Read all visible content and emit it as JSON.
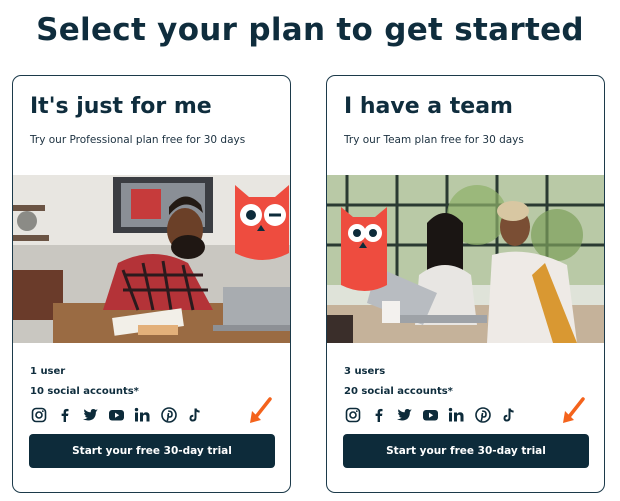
{
  "headline": "Select your plan to get started",
  "plans": [
    {
      "title": "It's just for me",
      "subtitle": "Try our Professional plan free for 30 days",
      "users": "1 user",
      "accounts": "10 social accounts*",
      "cta": "Start your free 30-day trial",
      "image": "man-working-at-desk-photo"
    },
    {
      "title": "I have a team",
      "subtitle": "Try our Team plan free for 30 days",
      "users": "3 users",
      "accounts": "20 social accounts*",
      "cta": "Start your free 30-day trial",
      "image": "two-women-at-laptop-photo"
    }
  ],
  "socials": [
    "instagram-icon",
    "facebook-icon",
    "twitter-icon",
    "youtube-icon",
    "linkedin-icon",
    "pinterest-icon",
    "tiktok-icon"
  ],
  "colors": {
    "navy": "#0d2b3a",
    "owl_red": "#ee4c3f",
    "arrow_orange": "#f4631c"
  }
}
